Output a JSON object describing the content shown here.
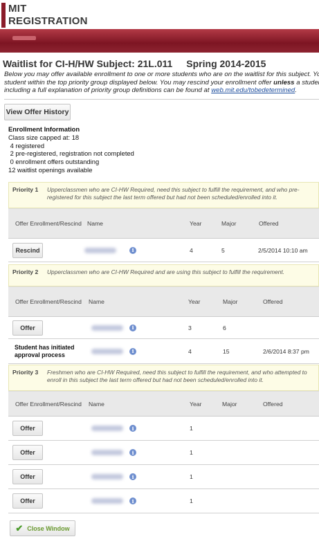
{
  "logo": {
    "line1": "MIT",
    "line2": "REGISTRATION"
  },
  "page": {
    "title": "Waitlist for CI-H/HW Subject: 21L.011",
    "term": "Spring 2014-2015",
    "intro_line1": "Below you may offer available enrollment to one or more students who are on the waitlist for this subject.  You are strongl",
    "intro_line2_a": "student within the top priority group displayed below. You may rescind your enrollment offer ",
    "intro_line2_b": "unless",
    "intro_line2_c": " a student's Add reque",
    "intro_line3_a": "including a full explanation of priority group definitions can be found at ",
    "intro_link": "web.mit.edu/tobedetermined",
    "intro_line3_b": "."
  },
  "buttons": {
    "history": "View Offer History",
    "close": "Close Window",
    "rescind": "Rescind",
    "offer": "Offer"
  },
  "enrollment": {
    "heading": "Enrollment Information",
    "lines": [
      "Class size capped at: 18",
      " 4 registered",
      " 2 pre-registered, registration not completed",
      " 0 enrollment offers outstanding",
      "12 waitlist openings available"
    ]
  },
  "table_headers": {
    "offer": "Offer Enrollment/Rescind",
    "name": "Name",
    "year": "Year",
    "major": "Major",
    "offered": "Offered"
  },
  "priority1": {
    "label": "Priority 1",
    "desc": "Upperclassmen who are CI-HW Required, need this subject to fulfill the requirement, and who pre-registered for this subject the last term offered but had not been scheduled/enrolled into it.",
    "rows": [
      {
        "year": "4",
        "major": "5",
        "offered": "2/5/2014 10:10 am"
      }
    ]
  },
  "priority2": {
    "label": "Priority 2",
    "desc": "Upperclassmen who are CI-HW Required and are using this subject to fulfill the requirement.",
    "rows": [
      {
        "year": "3",
        "major": "6",
        "offered": ""
      },
      {
        "status": "Student has initiated approval process",
        "year": "4",
        "major": "15",
        "offered": "2/6/2014  8:37 pm"
      }
    ]
  },
  "priority3": {
    "label": "Priority 3",
    "desc": "Freshmen who are CI-HW Required, need this subject to fulfill the requirement, and who attempted to enroll in this subject the last term offered but had not been scheduled/enrolled into it.",
    "rows": [
      {
        "year": "1"
      },
      {
        "year": "1"
      },
      {
        "year": "1"
      },
      {
        "year": "1"
      }
    ]
  },
  "icons": {
    "info": "info-icon",
    "check": "checkmark-icon"
  },
  "colors": {
    "brand": "#8a1c2a",
    "banner": "#8e2431",
    "priority_bg": "#fdfce6",
    "link": "#1a4b9c",
    "check": "#4a9a2a"
  }
}
